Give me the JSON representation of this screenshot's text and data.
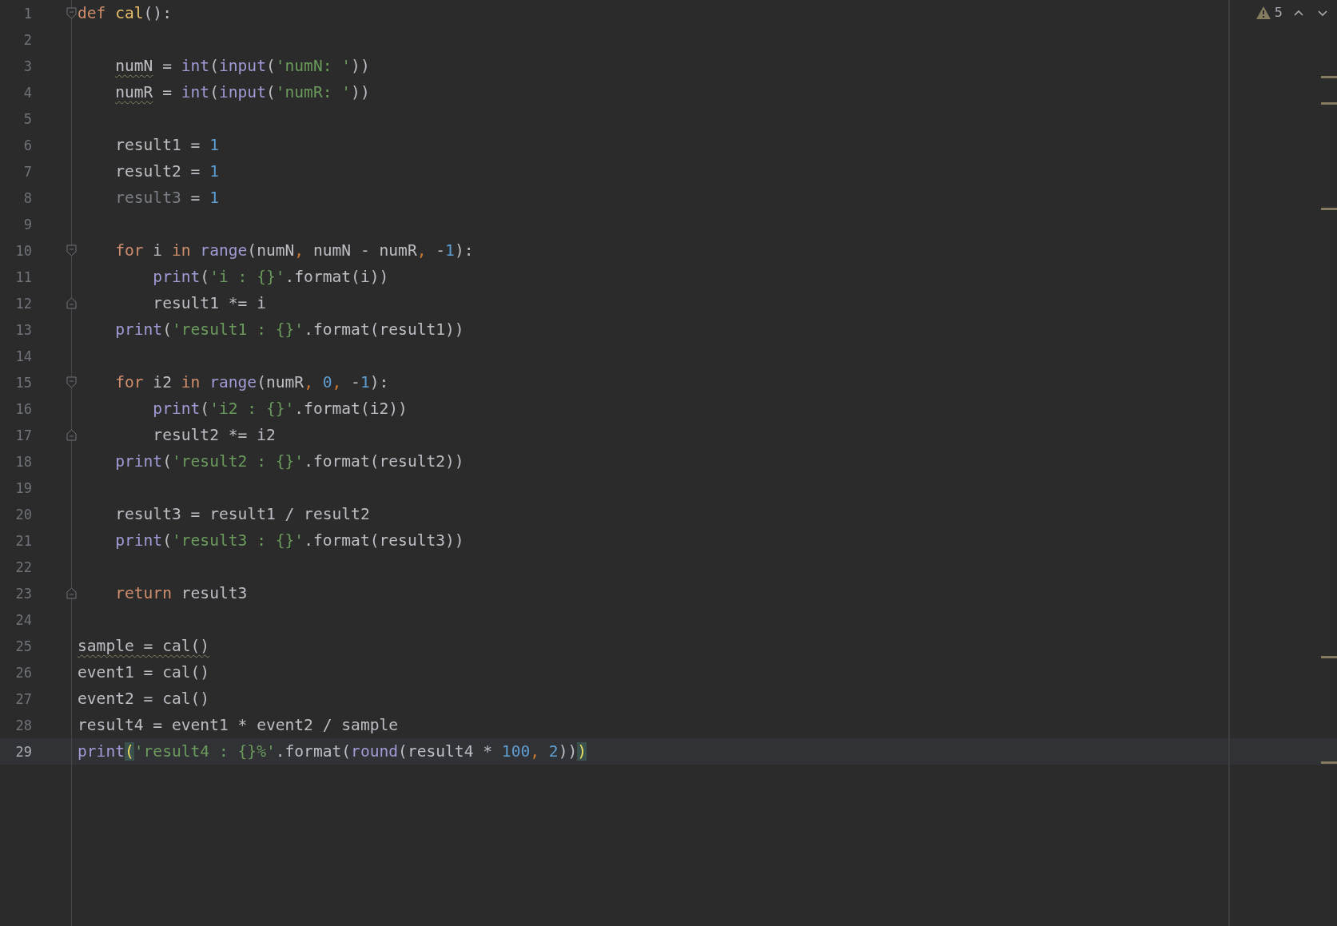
{
  "inspection": {
    "warning_count": "5"
  },
  "lines": [
    {
      "number": "1",
      "kind": "fold-start",
      "current": false,
      "warning": false,
      "tokens": [
        {
          "kind": "kw",
          "text": "def "
        },
        {
          "kind": "def",
          "text": "cal"
        },
        {
          "kind": "plain",
          "text": "():"
        }
      ]
    },
    {
      "number": "2",
      "kind": "plain",
      "current": false,
      "warning": false
    },
    {
      "number": "3",
      "kind": "plain",
      "current": false,
      "warning": true,
      "tokens": [
        {
          "kind": "warn",
          "text": "    numN"
        },
        {
          "kind": "plain",
          "text": " = "
        },
        {
          "kind": "fn",
          "text": "int"
        },
        {
          "kind": "plain",
          "text": "("
        },
        {
          "kind": "fn",
          "text": "input"
        },
        {
          "kind": "plain",
          "text": "("
        },
        {
          "kind": "str",
          "text": "'numN: '"
        },
        {
          "kind": "plain",
          "text": "))"
        }
      ]
    },
    {
      "number": "4",
      "kind": "plain",
      "current": false,
      "warning": true,
      "tokens": [
        {
          "kind": "warn",
          "text": "    numR"
        },
        {
          "kind": "plain",
          "text": " = "
        },
        {
          "kind": "fn",
          "text": "int"
        },
        {
          "kind": "plain",
          "text": "("
        },
        {
          "kind": "fn",
          "text": "input"
        },
        {
          "kind": "plain",
          "text": "("
        },
        {
          "kind": "str",
          "text": "'numR: '"
        },
        {
          "kind": "plain",
          "text": "))"
        }
      ]
    },
    {
      "number": "5",
      "kind": "plain",
      "current": false,
      "warning": false
    },
    {
      "number": "6",
      "kind": "plain",
      "current": false,
      "warning": false,
      "tokens": [
        {
          "kind": "plain",
          "text": "    result1 = "
        },
        {
          "kind": "num",
          "text": "1"
        }
      ]
    },
    {
      "number": "7",
      "kind": "plain",
      "current": false,
      "warning": false,
      "tokens": [
        {
          "kind": "plain",
          "text": "    result2 = "
        },
        {
          "kind": "num",
          "text": "1"
        }
      ]
    },
    {
      "number": "8",
      "kind": "plain",
      "current": false,
      "warning": true,
      "tokens": [
        {
          "kind": "dim",
          "text": "    result3"
        },
        {
          "kind": "plain",
          "text": " = "
        },
        {
          "kind": "num",
          "text": "1"
        }
      ]
    },
    {
      "number": "9",
      "kind": "plain",
      "current": false,
      "warning": false
    },
    {
      "number": "10",
      "kind": "fold-start",
      "current": false,
      "warning": false,
      "tokens": [
        {
          "kind": "kw",
          "text": "    for"
        },
        {
          "kind": "plain",
          "text": " i "
        },
        {
          "kind": "kw",
          "text": "in "
        },
        {
          "kind": "fn",
          "text": "range"
        },
        {
          "kind": "plain",
          "text": "(numN"
        },
        {
          "kind": "comma",
          "text": ","
        },
        {
          "kind": "plain",
          "text": " numN - numR"
        },
        {
          "kind": "comma",
          "text": ","
        },
        {
          "kind": "plain",
          "text": " -"
        },
        {
          "kind": "num",
          "text": "1"
        },
        {
          "kind": "plain",
          "text": "):"
        }
      ]
    },
    {
      "number": "11",
      "kind": "plain",
      "current": false,
      "warning": false,
      "tokens": [
        {
          "kind": "fn",
          "text": "        print"
        },
        {
          "kind": "plain",
          "text": "("
        },
        {
          "kind": "str",
          "text": "'i : {}'"
        },
        {
          "kind": "plain",
          "text": ".format(i))"
        }
      ]
    },
    {
      "number": "12",
      "kind": "fold-end",
      "current": false,
      "warning": false,
      "tokens": [
        {
          "kind": "plain",
          "text": "        result1 *= i"
        }
      ]
    },
    {
      "number": "13",
      "kind": "plain",
      "current": false,
      "warning": false,
      "tokens": [
        {
          "kind": "fn",
          "text": "    print"
        },
        {
          "kind": "plain",
          "text": "("
        },
        {
          "kind": "str",
          "text": "'result1 : {}'"
        },
        {
          "kind": "plain",
          "text": ".format(result1))"
        }
      ]
    },
    {
      "number": "14",
      "kind": "plain",
      "current": false,
      "warning": false
    },
    {
      "number": "15",
      "kind": "fold-start",
      "current": false,
      "warning": false,
      "tokens": [
        {
          "kind": "kw",
          "text": "    for"
        },
        {
          "kind": "plain",
          "text": " i2 "
        },
        {
          "kind": "kw",
          "text": "in "
        },
        {
          "kind": "fn",
          "text": "range"
        },
        {
          "kind": "plain",
          "text": "(numR"
        },
        {
          "kind": "comma",
          "text": ", "
        },
        {
          "kind": "num",
          "text": "0"
        },
        {
          "kind": "comma",
          "text": ","
        },
        {
          "kind": "plain",
          "text": " -"
        },
        {
          "kind": "num",
          "text": "1"
        },
        {
          "kind": "plain",
          "text": "):"
        }
      ]
    },
    {
      "number": "16",
      "kind": "plain",
      "current": false,
      "warning": false,
      "tokens": [
        {
          "kind": "fn",
          "text": "        print"
        },
        {
          "kind": "plain",
          "text": "("
        },
        {
          "kind": "str",
          "text": "'i2 : {}'"
        },
        {
          "kind": "plain",
          "text": ".format(i2))"
        }
      ]
    },
    {
      "number": "17",
      "kind": "fold-end",
      "current": false,
      "warning": false,
      "tokens": [
        {
          "kind": "plain",
          "text": "        result2 *= i2"
        }
      ]
    },
    {
      "number": "18",
      "kind": "plain",
      "current": false,
      "warning": false,
      "tokens": [
        {
          "kind": "fn",
          "text": "    print"
        },
        {
          "kind": "plain",
          "text": "("
        },
        {
          "kind": "str",
          "text": "'result2 : {}'"
        },
        {
          "kind": "plain",
          "text": ".format(result2))"
        }
      ]
    },
    {
      "number": "19",
      "kind": "plain",
      "current": false,
      "warning": false
    },
    {
      "number": "20",
      "kind": "plain",
      "current": false,
      "warning": false,
      "tokens": [
        {
          "kind": "plain",
          "text": "    result3 = result1 / result2"
        }
      ]
    },
    {
      "number": "21",
      "kind": "plain",
      "current": false,
      "warning": false,
      "tokens": [
        {
          "kind": "fn",
          "text": "    print"
        },
        {
          "kind": "plain",
          "text": "("
        },
        {
          "kind": "str",
          "text": "'result3 : {}'"
        },
        {
          "kind": "plain",
          "text": ".format(result3))"
        }
      ]
    },
    {
      "number": "22",
      "kind": "plain",
      "current": false,
      "warning": false
    },
    {
      "number": "23",
      "kind": "fold-end",
      "current": false,
      "warning": false,
      "tokens": [
        {
          "kind": "kw",
          "text": "    return"
        },
        {
          "kind": "plain",
          "text": " result3"
        }
      ]
    },
    {
      "number": "24",
      "kind": "plain",
      "current": false,
      "warning": false
    },
    {
      "number": "25",
      "kind": "plain",
      "current": false,
      "warning": true,
      "tokens": [
        {
          "kind": "warn",
          "text": "sample = cal()"
        }
      ]
    },
    {
      "number": "26",
      "kind": "plain",
      "current": false,
      "warning": false,
      "tokens": [
        {
          "kind": "plain",
          "text": "event1 = cal()"
        }
      ]
    },
    {
      "number": "27",
      "kind": "plain",
      "current": false,
      "warning": false,
      "tokens": [
        {
          "kind": "plain",
          "text": "event2 = cal()"
        }
      ]
    },
    {
      "number": "28",
      "kind": "plain",
      "current": false,
      "warning": false,
      "tokens": [
        {
          "kind": "plain",
          "text": "result4 = event1 * event2 / sample"
        }
      ]
    },
    {
      "number": "29",
      "kind": "plain",
      "current": true,
      "warning": true,
      "tokens": [
        {
          "kind": "fn",
          "text": "print"
        },
        {
          "kind": "match",
          "text": "("
        },
        {
          "kind": "str",
          "text": "'result4 : {}%'"
        },
        {
          "kind": "plain",
          "text": ".format("
        },
        {
          "kind": "fn",
          "text": "round"
        },
        {
          "kind": "plain",
          "text": "(result4 * "
        },
        {
          "kind": "num",
          "text": "100"
        },
        {
          "kind": "comma",
          "text": ", "
        },
        {
          "kind": "num",
          "text": "2"
        },
        {
          "kind": "plain",
          "text": "))"
        },
        {
          "kind": "match",
          "text": ")"
        }
      ]
    }
  ]
}
